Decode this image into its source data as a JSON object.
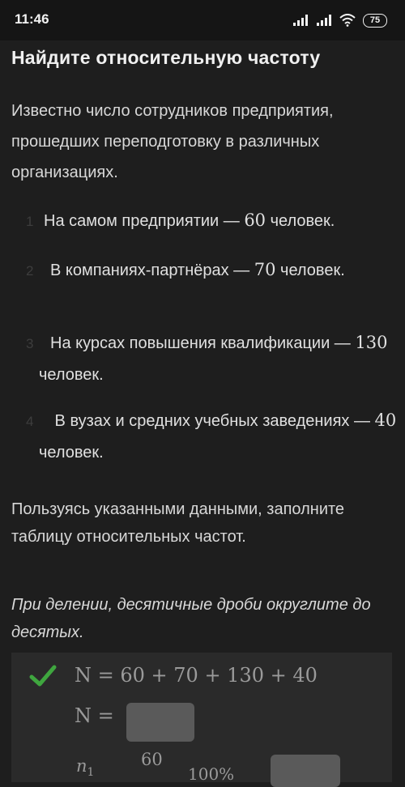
{
  "status": {
    "time": "11:46",
    "battery": "75"
  },
  "title": "Найдите относительную частоту",
  "intro": "Известно число сотрудников предприятия, прошедших переподготовку в различных организациях.",
  "items": [
    {
      "num": "1",
      "pre": "На самом предприятии — ",
      "value": "60",
      "post": " человек."
    },
    {
      "num": "2",
      "pre": "В компаниях-партнёрах — ",
      "value": "70",
      "post": " человек."
    },
    {
      "num": "3",
      "pre": "На курсах повышения квалификации — ",
      "value": "130",
      "post": " человек."
    },
    {
      "num": "4",
      "pre": " В вузах и средних учебных заведениях — ",
      "value": "40",
      "post": " человек."
    }
  ],
  "instruction": "Пользуясь указанными данными, заполните таблицу относительных частот.",
  "note": "При делении, десятичные дроби округлите до десятых.",
  "answer": {
    "formula_sum": "N = 60 + 70 + 130 + 40",
    "formula_n": "N =",
    "formula_n1_var": "n",
    "formula_n1_sub": "1",
    "formula_n1_num": "60",
    "formula_n1_percent": "100%",
    "n_input_value": "",
    "n1_input_value": ""
  },
  "colors": {
    "background": "#1e1e1e",
    "check": "#3fa63f",
    "input": "#5a5a5a"
  }
}
